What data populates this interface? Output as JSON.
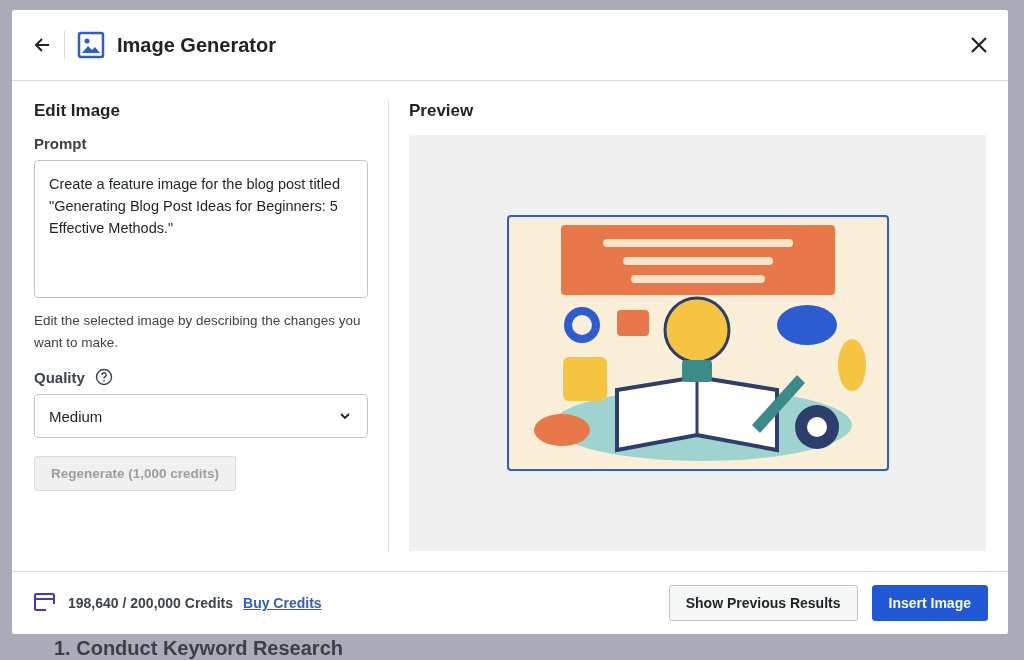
{
  "dialog": {
    "title": "Image Generator"
  },
  "edit_panel": {
    "heading": "Edit Image",
    "prompt_label": "Prompt",
    "prompt_value": "Create a feature image for the blog post titled \"Generating Blog Post Ideas for Beginners: 5 Effective Methods.\"",
    "help_text": "Edit the selected image by describing the changes you want to make.",
    "quality_label": "Quality",
    "quality_value": "Medium",
    "regenerate": {
      "label": "Regenerate (1,000 credits)",
      "disabled": true
    }
  },
  "preview_panel": {
    "heading": "Preview"
  },
  "footer": {
    "credits": "198,640 / 200,000 Credits",
    "buy_link": "Buy Credits",
    "buttons": [
      {
        "label": "Show Previous Results",
        "kind": "secondary"
      },
      {
        "label": "Insert Image",
        "kind": "primary"
      }
    ]
  },
  "background_heading": "1. Conduct Keyword Research"
}
